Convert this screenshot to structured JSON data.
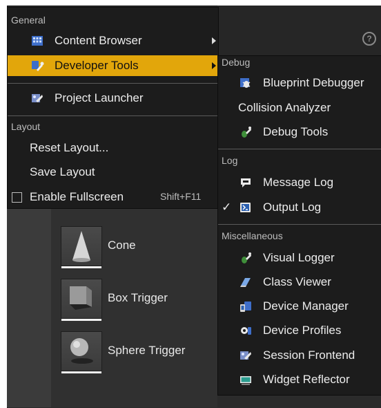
{
  "main_menu": {
    "general_header": "General",
    "content_browser": "Content Browser",
    "developer_tools": "Developer Tools",
    "project_launcher": "Project Launcher",
    "layout_header": "Layout",
    "reset_layout": "Reset Layout...",
    "save_layout": "Save Layout",
    "enable_fullscreen": "Enable Fullscreen",
    "enable_fullscreen_shortcut": "Shift+F11"
  },
  "submenu": {
    "debug_header": "Debug",
    "blueprint_debugger": "Blueprint Debugger",
    "collision_analyzer": "Collision Analyzer",
    "debug_tools": "Debug Tools",
    "log_header": "Log",
    "message_log": "Message Log",
    "output_log": "Output Log",
    "output_log_checked": "✓",
    "misc_header": "Miscellaneous",
    "visual_logger": "Visual Logger",
    "class_viewer": "Class Viewer",
    "device_manager": "Device Manager",
    "device_profiles": "Device Profiles",
    "session_frontend": "Session Frontend",
    "widget_reflector": "Widget Reflector"
  },
  "assets": {
    "cone": "Cone",
    "box_trigger": "Box Trigger",
    "sphere_trigger": "Sphere Trigger"
  },
  "toolbar": {
    "help": "?"
  },
  "colors": {
    "highlight": "#e2a60b",
    "menu_bg": "#1c1c1c",
    "panel_bg": "#303030"
  },
  "icons": {
    "content_browser": "grid-icon",
    "developer_tools": "wrench-icon",
    "project_launcher": "launcher-icon",
    "blueprint_debugger": "bug-icon",
    "debug_tools": "bug-wrench-icon",
    "message_log": "speech-bubble-icon",
    "output_log": "terminal-icon",
    "visual_logger": "bug-wrench-icon",
    "class_viewer": "book-icon",
    "device_manager": "device-icon",
    "device_profiles": "gear-device-icon",
    "session_frontend": "launcher-icon",
    "widget_reflector": "monitor-icon"
  }
}
